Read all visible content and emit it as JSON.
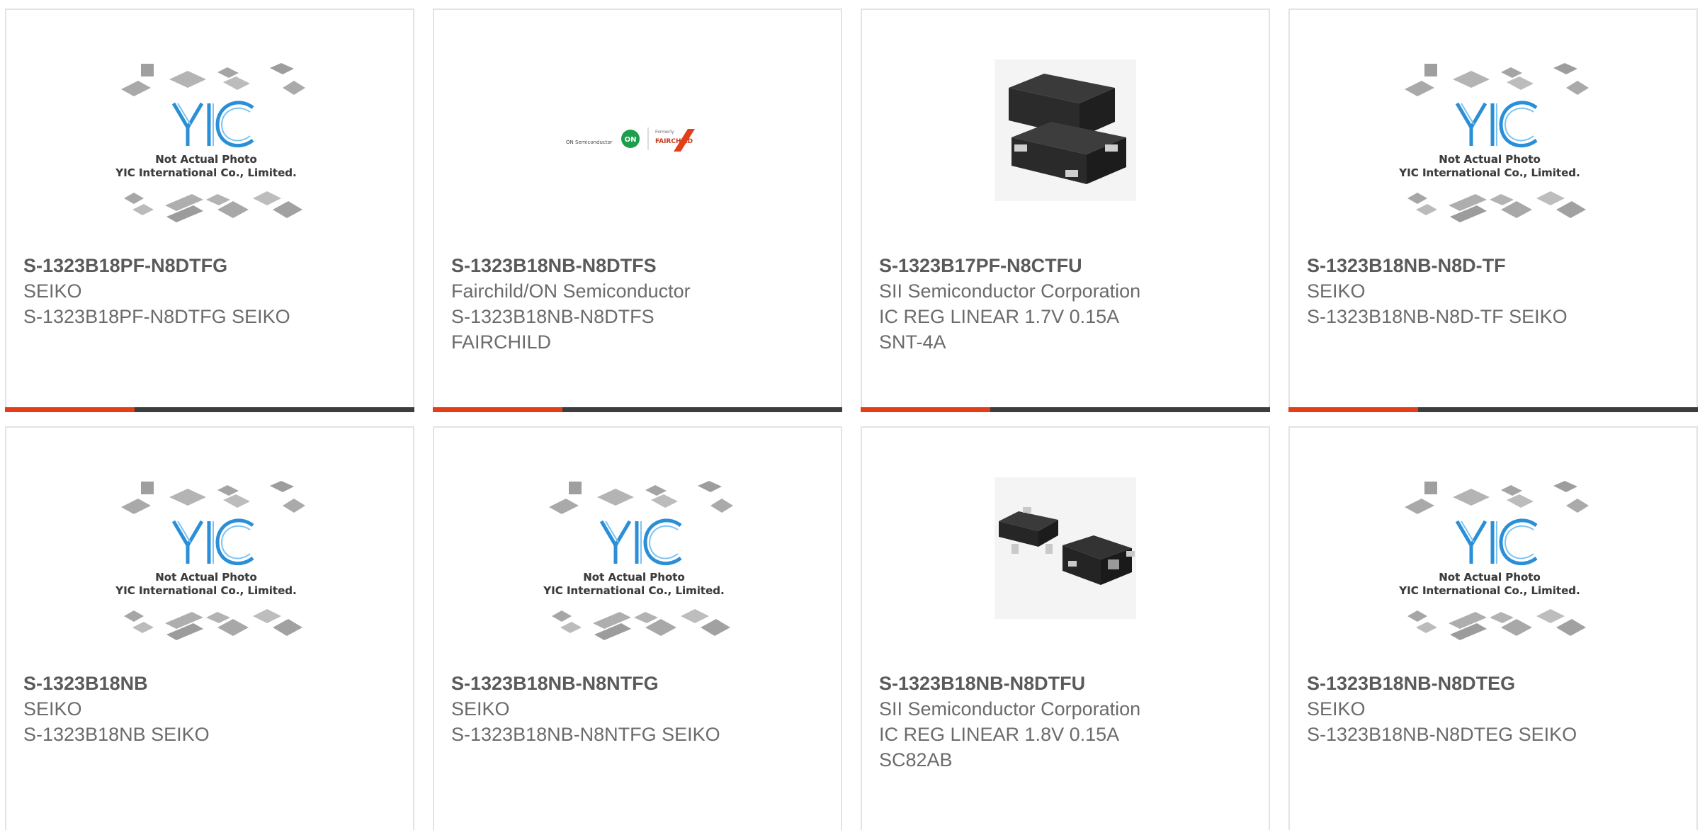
{
  "placeholder": {
    "brand": "YIC",
    "caption_line1": "Not Actual Photo",
    "caption_line2": "YIC International Co., Limited."
  },
  "fairchild_logo": {
    "left_text": "ON Semiconductor",
    "badge": "ON",
    "formerly": "Formerly",
    "brand": "FAIRCHILD"
  },
  "colors": {
    "accent": "#e23e18",
    "bar": "#3d3d3d",
    "border": "#e3e3e3",
    "text": "#6b6b6b",
    "yic_blue": "#2a8fd6"
  },
  "products": [
    {
      "part_number": "S-1323B18PF-N8DTFG",
      "manufacturer": "SEIKO",
      "desc1": "S-1323B18PF-N8DTFG SEIKO",
      "desc2": "",
      "image": "yic-placeholder-image"
    },
    {
      "part_number": "S-1323B18NB-N8DTFS",
      "manufacturer": "Fairchild/ON Semiconductor",
      "desc1": "S-1323B18NB-N8DTFS",
      "desc2": "FAIRCHILD",
      "image": "fairchild-logo-image"
    },
    {
      "part_number": "S-1323B17PF-N8CTFU",
      "manufacturer": "SII Semiconductor Corporation",
      "desc1": "IC REG LINEAR 1.7V 0.15A",
      "desc2": "SNT-4A",
      "image": "snt4a-package-photo"
    },
    {
      "part_number": "S-1323B18NB-N8D-TF",
      "manufacturer": "SEIKO",
      "desc1": "S-1323B18NB-N8D-TF SEIKO",
      "desc2": "",
      "image": "yic-placeholder-image"
    },
    {
      "part_number": "S-1323B18NB",
      "manufacturer": "SEIKO",
      "desc1": "S-1323B18NB SEIKO",
      "desc2": "",
      "image": "yic-placeholder-image"
    },
    {
      "part_number": "S-1323B18NB-N8NTFG",
      "manufacturer": "SEIKO",
      "desc1": "S-1323B18NB-N8NTFG SEIKO",
      "desc2": "",
      "image": "yic-placeholder-image"
    },
    {
      "part_number": "S-1323B18NB-N8DTFU",
      "manufacturer": "SII Semiconductor Corporation",
      "desc1": "IC REG LINEAR 1.8V 0.15A",
      "desc2": "SC82AB",
      "image": "sc82ab-package-photo"
    },
    {
      "part_number": "S-1323B18NB-N8DTEG",
      "manufacturer": "SEIKO",
      "desc1": "S-1323B18NB-N8DTEG SEIKO",
      "desc2": "",
      "image": "yic-placeholder-image"
    }
  ]
}
